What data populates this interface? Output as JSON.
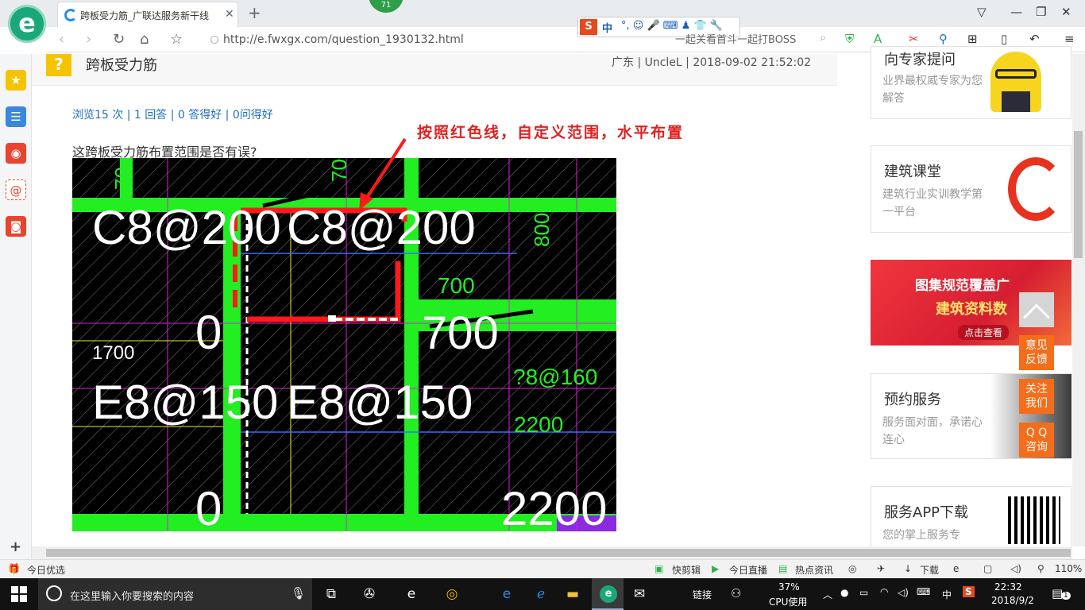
{
  "browser": {
    "badge_count": "71",
    "tab_title": "跨板受力筋_广联达服务新干线",
    "url": "http://e.fwxgx.com/question_1930132.html",
    "search_text": "一起关看首斗一起打BOSS",
    "ime_label": "中"
  },
  "question": {
    "title": "跨板受力筋",
    "meta": "广东 | UncleL | 2018-09-02 21:52:02",
    "stats": "浏览15 次 | 1 回答 | 0 答得好 | 0问得好",
    "body": "这跨板受力筋布置范围是否有误?",
    "annotation": "按照红色线，自定义范围，水平布置"
  },
  "cad": {
    "texts": [
      "C8@200",
      "C8@200",
      "700",
      "700",
      "1700",
      "E8@150",
      "E8@150",
      "?8@160",
      "2200",
      "2200",
      "800",
      "0",
      "0",
      "70",
      "70"
    ]
  },
  "ads": {
    "expert": {
      "title": "向专家提问",
      "desc": "业界最权威专家为您解答"
    },
    "course": {
      "title": "建筑课堂",
      "desc": "建筑行业实训教学第一平台"
    },
    "atlas": {
      "line1": "图集规范覆盖广",
      "line2": "建筑资料数",
      "cta": "点击查看"
    },
    "booking": {
      "title": "预约服务",
      "desc": "服务面对面，承诺心连心"
    },
    "app": {
      "title": "服务APP下载",
      "desc": "您的掌上服务专"
    }
  },
  "float_buttons": [
    "意见\n反馈",
    "关注\n我们",
    "Q Q\n咨询"
  ],
  "statusbar": {
    "left": "今日优选",
    "items": [
      "快剪辑",
      "今日直播",
      "热点资讯",
      "下载"
    ],
    "zoom": "110%"
  },
  "taskbar": {
    "search_placeholder": "在这里输入你要搜索的内容",
    "link_label": "链接",
    "cpu_pct": "37%",
    "cpu_label": "CPU使用",
    "ime": "中",
    "time": "22:32",
    "date": "2018/9/2",
    "notif": "1"
  },
  "colors": {
    "accent": "#1f6fbf",
    "cad_green": "#22ee22",
    "cad_magenta": "#e020e0",
    "annot_red": "#e02020"
  }
}
